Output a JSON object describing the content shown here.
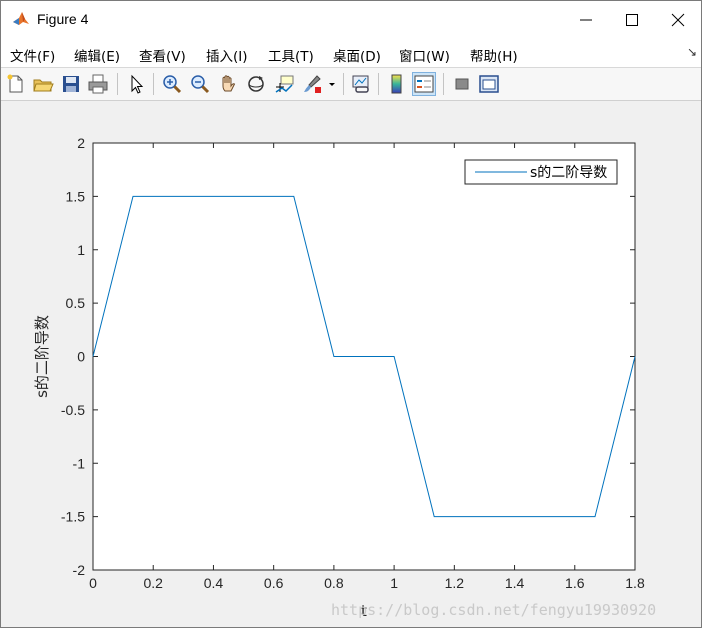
{
  "window": {
    "title": "Figure 4"
  },
  "menu": {
    "items": [
      {
        "label": "文件(F)",
        "name": "menu-file"
      },
      {
        "label": "编辑(E)",
        "name": "menu-edit"
      },
      {
        "label": "查看(V)",
        "name": "menu-view"
      },
      {
        "label": "插入(I)",
        "name": "menu-insert"
      },
      {
        "label": "工具(T)",
        "name": "menu-tools"
      },
      {
        "label": "桌面(D)",
        "name": "menu-desktop"
      },
      {
        "label": "窗口(W)",
        "name": "menu-window"
      },
      {
        "label": "帮助(H)",
        "name": "menu-help"
      }
    ]
  },
  "toolbar": {
    "icons": [
      "new-figure-icon",
      "open-file-icon",
      "save-icon",
      "print-icon",
      "select-pointer-icon",
      "zoom-in-icon",
      "zoom-out-icon",
      "pan-hand-icon",
      "rotate-3d-icon",
      "data-cursor-icon",
      "brush-icon",
      "link-plot-icon",
      "colorbar-icon",
      "legend-icon",
      "hide-plot-tools-icon",
      "show-plot-tools-icon"
    ]
  },
  "colors": {
    "line": "#0072bd",
    "axes_bg": "#ffffff",
    "figure_bg": "#f0f0f0"
  },
  "watermark": "https://blog.csdn.net/fengyu19930920",
  "chart_data": {
    "type": "line",
    "title": "",
    "xlabel": "t",
    "ylabel": "s的二阶导数",
    "xlim": [
      0,
      1.8
    ],
    "ylim": [
      -2,
      2
    ],
    "xticks": [
      0,
      0.2,
      0.4,
      0.6,
      0.8,
      1,
      1.2,
      1.4,
      1.6,
      1.8
    ],
    "xtick_labels": [
      "0",
      "0.2",
      "0.4",
      "0.6",
      "0.8",
      "1",
      "1.2",
      "1.4",
      "1.6",
      "1.8"
    ],
    "yticks": [
      -2,
      -1.5,
      -1,
      -0.5,
      0,
      0.5,
      1,
      1.5,
      2
    ],
    "ytick_labels": [
      "-2",
      "-1.5",
      "-1",
      "-0.5",
      "0",
      "0.5",
      "1",
      "1.5",
      "2"
    ],
    "grid": false,
    "legend_position": "top-right",
    "series": [
      {
        "name": "s的二阶导数",
        "x": [
          0,
          0.133,
          0.667,
          0.8,
          1.0,
          1.133,
          1.667,
          1.8
        ],
        "y": [
          0,
          1.5,
          1.5,
          0,
          0,
          -1.5,
          -1.5,
          0
        ]
      }
    ]
  }
}
